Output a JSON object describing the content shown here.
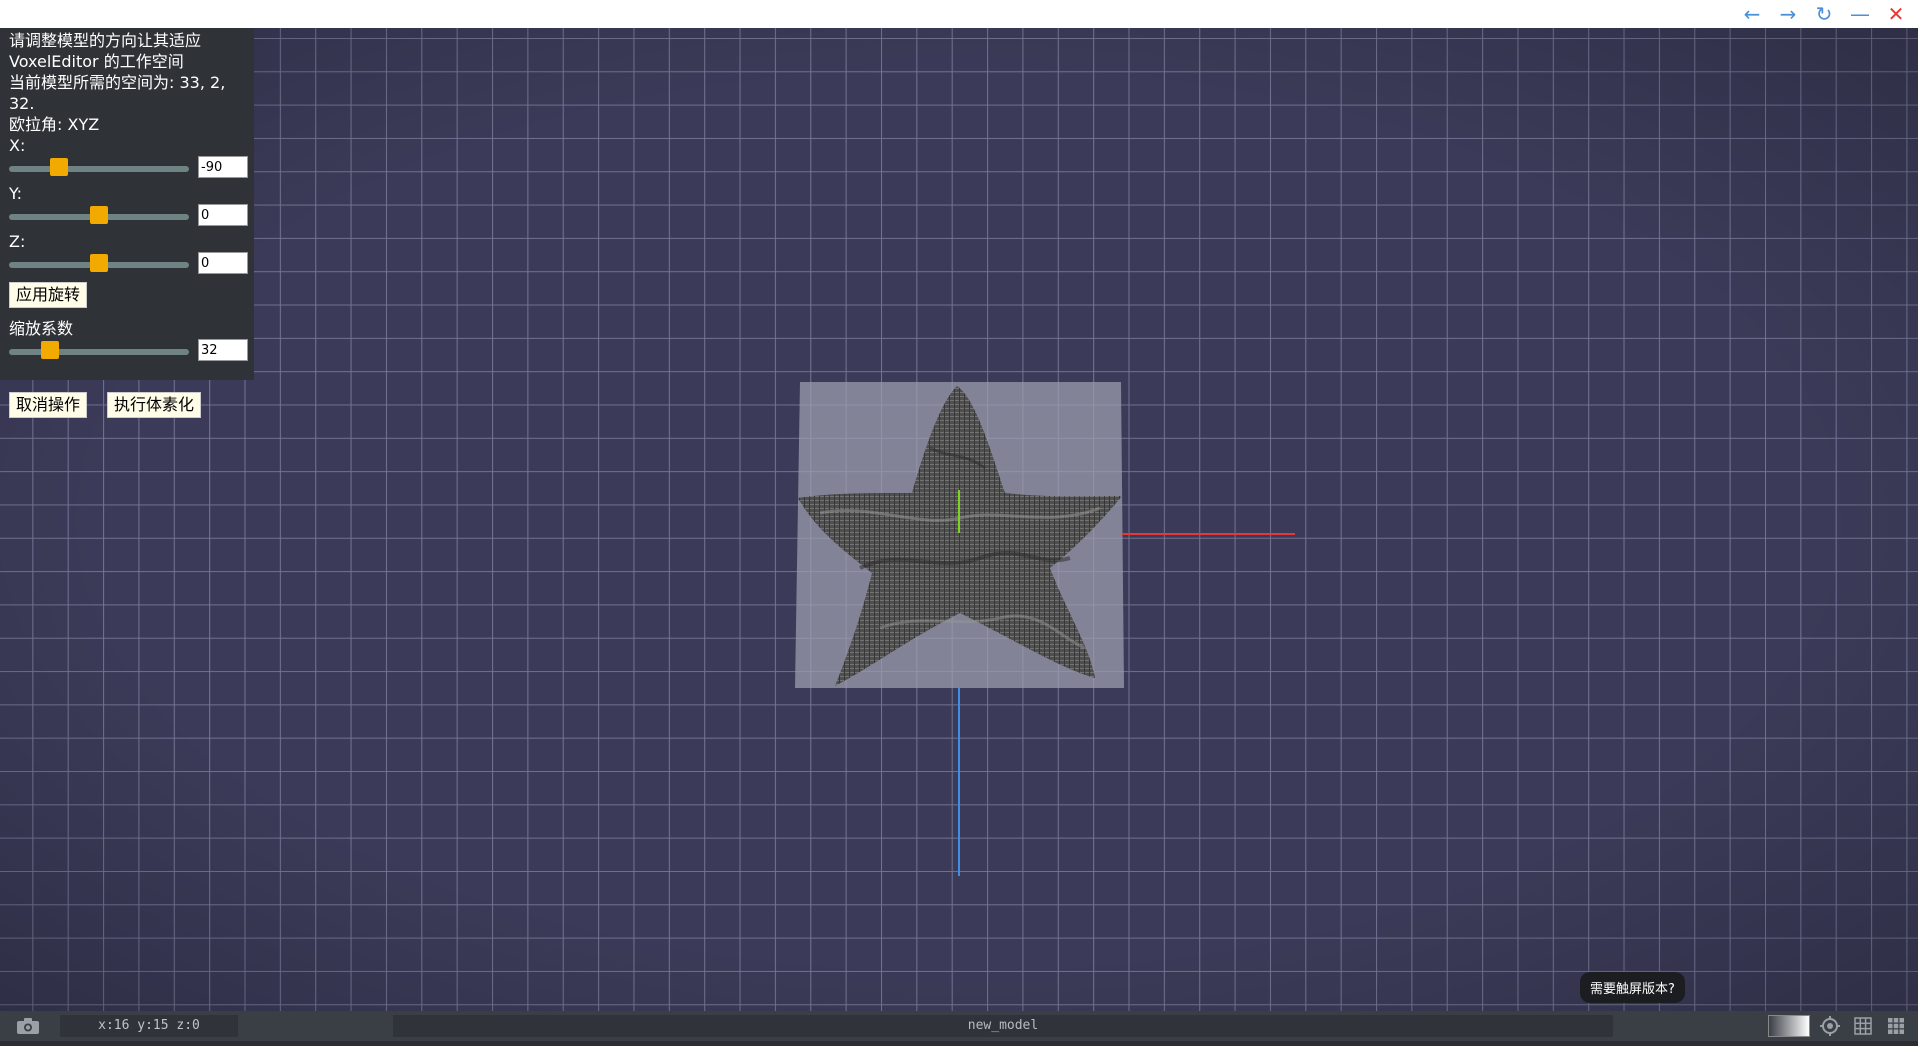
{
  "window": {
    "controls": [
      {
        "name": "back-icon",
        "glyph": "←"
      },
      {
        "name": "forward-icon",
        "glyph": "→"
      },
      {
        "name": "refresh-icon",
        "glyph": "↻"
      },
      {
        "name": "minimize-icon",
        "glyph": "—"
      },
      {
        "name": "close-icon",
        "glyph": "✕"
      }
    ]
  },
  "panel": {
    "instruction_line1": "请调整模型的方向让其适应",
    "instruction_line2": "VoxelEditor 的工作空间",
    "space_line1": "当前模型所需的空间为: 33, 2,",
    "space_line2": "32.",
    "euler_label": "欧拉角: XYZ",
    "x_label": "X:",
    "x_value": "-90",
    "x_slider_fraction": 0.25,
    "y_label": "Y:",
    "y_value": "0",
    "y_slider_fraction": 0.5,
    "z_label": "Z:",
    "z_value": "0",
    "z_slider_fraction": 0.5,
    "apply_label": "应用旋转",
    "scale_label": "缩放系数",
    "scale_value": "32",
    "scale_slider_fraction": 0.2
  },
  "actions": {
    "cancel_label": "取消操作",
    "voxelize_label": "执行体素化"
  },
  "tooltip": {
    "text": "需要触屏版本?"
  },
  "statusbar": {
    "coords": "x:16 y:15 z:0",
    "model_name": "new_model"
  },
  "colors": {
    "background": "#3b3b59",
    "grid": "#6a6c8c",
    "axis_x": "#e53935",
    "axis_y": "#7ed321",
    "axis_z": "#3d8fe6",
    "slider_thumb": "#f2a900",
    "slider_track": "#6f8384",
    "panel_bg": "#2f3338",
    "button_bg": "#fffce8"
  }
}
